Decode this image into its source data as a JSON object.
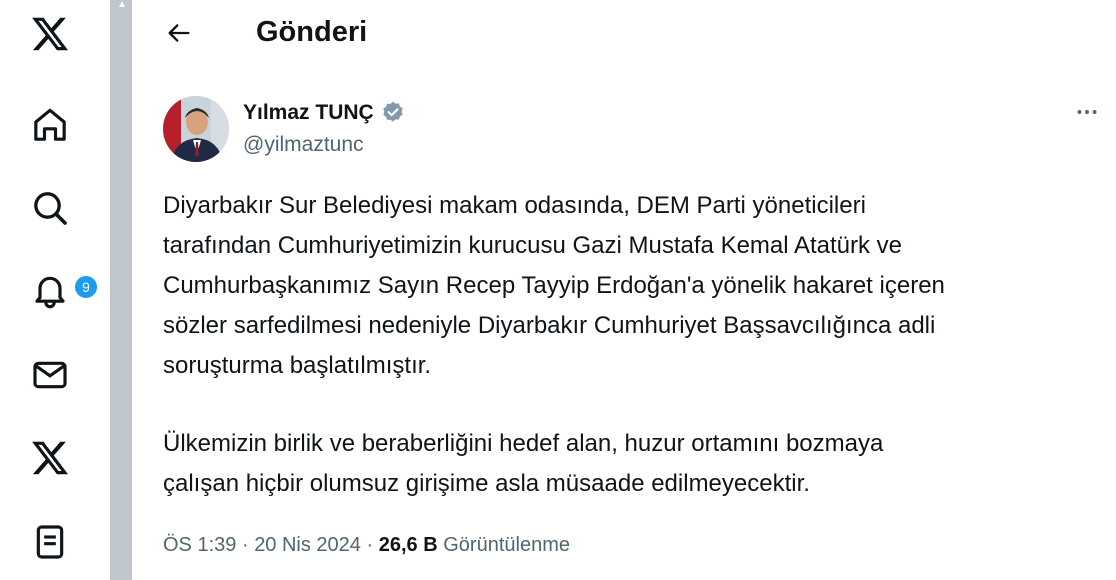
{
  "nav": {
    "items": [
      {
        "name": "x-logo-icon"
      },
      {
        "name": "home-icon"
      },
      {
        "name": "search-icon"
      },
      {
        "name": "notifications-bell-icon"
      },
      {
        "name": "messages-envelope-icon"
      },
      {
        "name": "grok-x-icon"
      },
      {
        "name": "lists-icon"
      }
    ],
    "notification_badge": "9"
  },
  "header": {
    "title": "Gönderi",
    "back_icon": "arrow-left-icon"
  },
  "tweet": {
    "author_name": "Yılmaz TUNÇ",
    "author_handle": "@yilmaztunc",
    "verified_icon": "verified-badge-icon",
    "more_icon": "more-horizontal-icon",
    "paragraphs": [
      "Diyarbakır Sur Belediyesi makam odasında, DEM Parti yöneticileri\ntarafından Cumhuriyetimizin kurucusu Gazi Mustafa Kemal Atatürk ve\nCumhurbaşkanımız Sayın Recep Tayyip Erdoğan'a yönelik hakaret içeren\nsözler sarfedilmesi nedeniyle Diyarbakır Cumhuriyet Başsavcılığınca adli\nsoruşturma başlatılmıştır.",
      "Ülkemizin birlik ve beraberliğini hedef alan, huzur ortamını bozmaya\nçalışan hiçbir olumsuz girişime asla müsaade edilmeyecektir."
    ],
    "time": "ÖS 1:39",
    "separator": "·",
    "date": "20 Nis 2024",
    "views_count": "26,6 B",
    "views_label": "Görüntülenme"
  },
  "colors": {
    "accent": "#1d9bf0",
    "text_primary": "#0f1419",
    "text_secondary": "#536471",
    "scrollbar": "#c4c4c4"
  }
}
